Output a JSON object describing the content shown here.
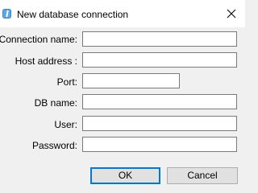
{
  "window": {
    "title": "New database connection",
    "icon": "app-icon",
    "close_icon": "close-icon"
  },
  "form": {
    "connection_name": {
      "label": "Connection name:",
      "value": ""
    },
    "host_address": {
      "label": "Host address :",
      "value": ""
    },
    "port": {
      "label": "Port:",
      "value": ""
    },
    "db_name": {
      "label": "DB name:",
      "value": ""
    },
    "user": {
      "label": "User:",
      "value": ""
    },
    "password": {
      "label": "Password:",
      "value": ""
    }
  },
  "buttons": {
    "ok": "OK",
    "cancel": "Cancel"
  },
  "colors": {
    "background": "#f0f0f0",
    "titlebar": "#ffffff",
    "default_button_border": "#0078d7",
    "field_border": "#7a7a7a"
  }
}
